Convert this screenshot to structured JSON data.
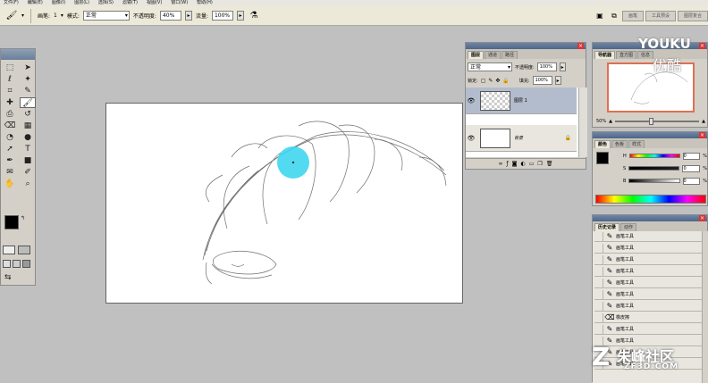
{
  "menu": [
    "文件(F)",
    "编辑(E)",
    "图像(I)",
    "图层(L)",
    "选择(S)",
    "滤镜(T)",
    "视图(V)",
    "窗口(W)",
    "帮助(H)"
  ],
  "options": {
    "brush_label": "画笔:",
    "brush_size": "1",
    "mode_label": "模式:",
    "mode_value": "正常",
    "opacity_label": "不透明度:",
    "opacity_value": "40%",
    "flow_label": "流量:",
    "flow_value": "100%"
  },
  "palette_well_tabs": [
    "画笔",
    "工具预设",
    "图层复合"
  ],
  "layers_panel": {
    "tabs": [
      "图层",
      "通道",
      "路径"
    ],
    "blend_mode": "正常",
    "opacity_label": "不透明度:",
    "opacity_value": "100%",
    "lock_label": "锁定:",
    "fill_label": "填充:",
    "fill_value": "100%",
    "layers": [
      {
        "name": "图层 1"
      },
      {
        "name": "背景"
      }
    ],
    "footer_icons": [
      "link-icon",
      "fx-icon",
      "mask-icon",
      "adjustment-icon",
      "folder-icon",
      "new-layer-icon",
      "trash-icon"
    ]
  },
  "navigator_panel": {
    "tabs": [
      "导航器",
      "直方图",
      "信息"
    ],
    "zoom_value": "50%"
  },
  "color_panel": {
    "tabs": [
      "颜色",
      "色板",
      "样式"
    ],
    "channels": [
      "H",
      "S",
      "B"
    ],
    "values": [
      "0",
      "0",
      "0"
    ],
    "percent": "%"
  },
  "history_panel": {
    "tabs": [
      "历史记录",
      "动作"
    ],
    "items": [
      "画笔工具",
      "画笔工具",
      "画笔工具",
      "画笔工具",
      "画笔工具",
      "画笔工具",
      "画笔工具",
      "橡皮擦",
      "画笔工具",
      "画笔工具",
      "画笔工具",
      "画笔工具"
    ]
  },
  "watermarks": {
    "youku": "YOUKU",
    "youku_cn": "优酷",
    "zf3d": "朱峰社区",
    "zf3d_url": "ZF3D.COM"
  },
  "colors": {
    "brush_cursor": "#3fd6f0",
    "canvas": "#ffffff",
    "workspace": "#c0c0c0"
  }
}
